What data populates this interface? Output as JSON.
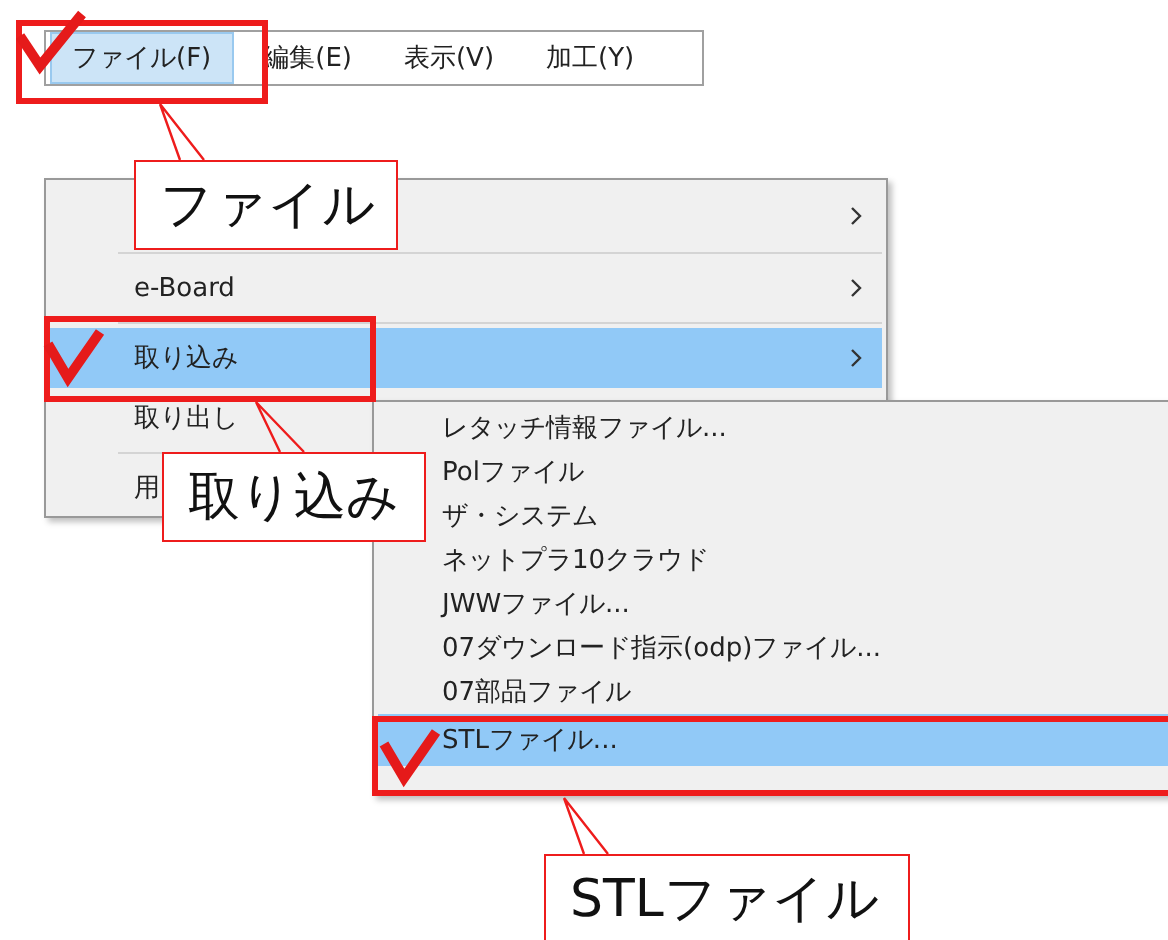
{
  "menu_bar": {
    "items": [
      {
        "label": "ファイル(F)",
        "selected": true
      },
      {
        "label": "編集(E)",
        "selected": false
      },
      {
        "label": "表示(V)",
        "selected": false
      },
      {
        "label": "加工(Y)",
        "selected": false
      }
    ]
  },
  "menu": {
    "items": [
      {
        "submenu": true,
        "selected": false,
        "separator_after": true
      },
      {
        "label": "e-Board",
        "submenu": true,
        "selected": false,
        "separator_after": true
      },
      {
        "label": "取り込み",
        "submenu": true,
        "selected": true,
        "separator_after": false
      },
      {
        "label": "取り出し",
        "submenu": false,
        "selected": false,
        "separator_after": true
      },
      {
        "label": "用",
        "submenu": false,
        "selected": false,
        "separator_after": false
      }
    ]
  },
  "submenu": {
    "items": [
      {
        "label": "レタッチ情報ファイル...",
        "selected": false
      },
      {
        "label": "Polファイル",
        "selected": false
      },
      {
        "label": "ザ・システム",
        "selected": false
      },
      {
        "label": "ネットプラ10クラウド",
        "selected": false
      },
      {
        "label": "JWWファイル...",
        "selected": false
      },
      {
        "label": "07ダウンロード指示(odp)ファイル...",
        "selected": false
      },
      {
        "label": "07部品ファイル",
        "selected": false
      },
      {
        "label": "STLファイル...",
        "selected": true
      }
    ]
  },
  "callouts": [
    "ファイル",
    "取り込み",
    "STLファイル"
  ]
}
